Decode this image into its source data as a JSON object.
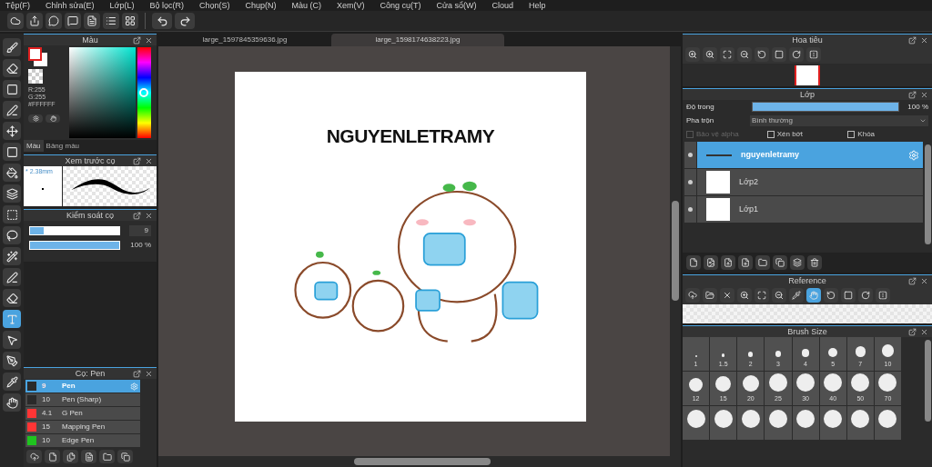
{
  "menu": [
    "Tệp(F)",
    "Chỉnh sửa(E)",
    "Lớp(L)",
    "Bộ lọc(R)",
    "Chọn(S)",
    "Chụp(N)",
    "Màu (C)",
    "Xem(V)",
    "Công cụ(T)",
    "Cửa sổ(W)",
    "Cloud",
    "Help"
  ],
  "tools": [
    {
      "selected": false
    },
    {
      "selected": false
    },
    {
      "selected": false
    },
    {
      "selected": false
    },
    {
      "selected": false
    },
    {
      "selected": false
    },
    {
      "selected": false
    },
    {
      "selected": false
    },
    {
      "selected": false
    },
    {
      "selected": false
    },
    {
      "selected": false
    },
    {
      "selected": false
    },
    {
      "selected": false
    },
    {
      "selected": true
    },
    {
      "selected": false
    },
    {
      "selected": false
    },
    {
      "selected": false
    },
    {
      "selected": false
    }
  ],
  "color_panel": {
    "title": "Màu",
    "r": "R:255",
    "g": "G:255",
    "hex": "#FFFFFF",
    "level": 0.5,
    "tabs": [
      {
        "label": "Màu",
        "selected": true
      },
      {
        "label": "Bảng màu",
        "selected": false
      }
    ]
  },
  "brush_preview": {
    "title": "Xem trước cọ",
    "size": "* 2.38mm"
  },
  "brush_control": {
    "title": "Kiểm soát cọ",
    "size_slider": {
      "level": 0.15
    },
    "size": "9",
    "opacity_slider": {
      "level": 1
    },
    "opacity": "100 %"
  },
  "brush_list": {
    "title": "Cọ: Pen",
    "items": [
      {
        "color": "#2a2a2a",
        "size": "9",
        "name": "Pen",
        "selected": true
      },
      {
        "color": "#2a2a2a",
        "size": "10",
        "name": "Pen (Sharp)",
        "selected": false
      },
      {
        "color": "#ff3535",
        "size": "4.1",
        "name": "G Pen",
        "selected": false
      },
      {
        "color": "#ff3535",
        "size": "15",
        "name": "Mapping Pen",
        "selected": false
      },
      {
        "color": "#1fc41f",
        "size": "10",
        "name": "Edge Pen",
        "selected": false
      }
    ]
  },
  "canvas": {
    "tabs": [
      {
        "label": "large_1597845359636.jpg",
        "selected": false
      },
      {
        "label": "large_1598174638223.jpg",
        "selected": true
      }
    ],
    "text": "NGUYENLETRAMY"
  },
  "navigator": {
    "title": "Hoa tiêu"
  },
  "layers": {
    "title": "Lớp",
    "opacity_label": "Độ trong",
    "opacity_slider": {
      "level": 1
    },
    "opacity": "100 %",
    "blend_label": "Pha trộn",
    "blend": "Bình thường",
    "options": [
      {
        "label": "Bảo vệ alpha",
        "checked": false,
        "disabled": true
      },
      {
        "label": "Xén bớt",
        "checked": false,
        "disabled": false
      },
      {
        "label": "Khóa",
        "checked": false,
        "disabled": false
      }
    ],
    "items": [
      {
        "name": "nguyenletramy",
        "selected": true,
        "kind": "text"
      },
      {
        "name": "Lớp2",
        "selected": false,
        "kind": "image"
      },
      {
        "name": "Lớp1",
        "selected": false,
        "kind": "image"
      }
    ]
  },
  "reference": {
    "title": "Reference",
    "tools": [
      {
        "selected": false
      },
      {
        "selected": false
      },
      {
        "selected": false
      },
      {
        "selected": false
      },
      {
        "selected": false
      },
      {
        "selected": false
      },
      {
        "selected": false
      },
      {
        "selected": true
      },
      {
        "selected": false
      },
      {
        "selected": false
      },
      {
        "selected": false
      },
      {
        "selected": false
      }
    ]
  },
  "brush_size": {
    "title": "Brush Size",
    "sizes": [
      "1",
      "1.5",
      "2",
      "3",
      "4",
      "5",
      "7",
      "10",
      "12",
      "15",
      "20",
      "25",
      "30",
      "40",
      "50",
      "70"
    ]
  }
}
